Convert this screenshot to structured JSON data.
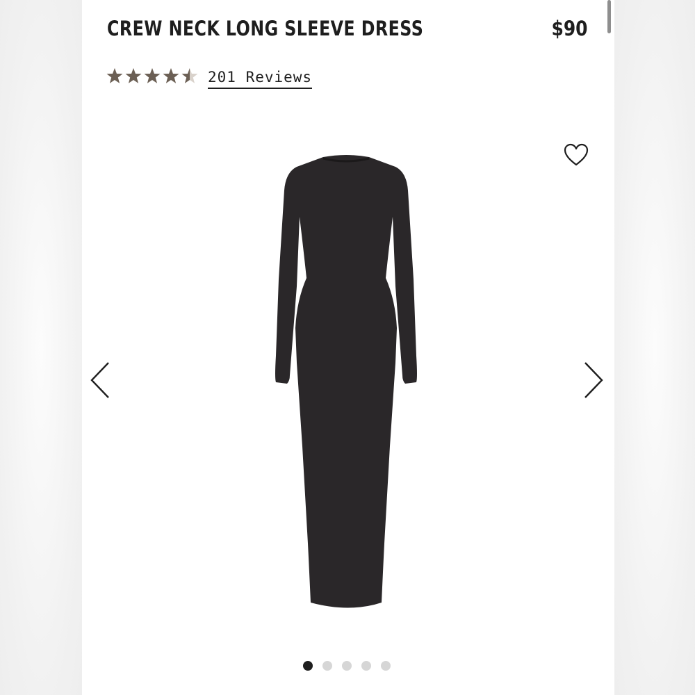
{
  "product": {
    "title": "CREW NECK LONG SLEEVE DRESS",
    "price": "$90",
    "rating": 4.5,
    "rating_max": 5,
    "reviews_label": "201 Reviews",
    "image_alt": "black crew neck long sleeve dress"
  },
  "carousel": {
    "total_slides": 5,
    "active_index": 0,
    "prev_icon": "chevron-left-icon",
    "next_icon": "chevron-right-icon"
  },
  "icons": {
    "wishlist": "heart-icon",
    "stars": "star-icon"
  },
  "colors": {
    "text": "#1e1e1e",
    "star": "#6b5f54",
    "star_empty": "#d9d2cb",
    "dot_active": "#1e1e1e",
    "dot_inactive": "#d6d6d6",
    "dress": "#2a2729"
  }
}
